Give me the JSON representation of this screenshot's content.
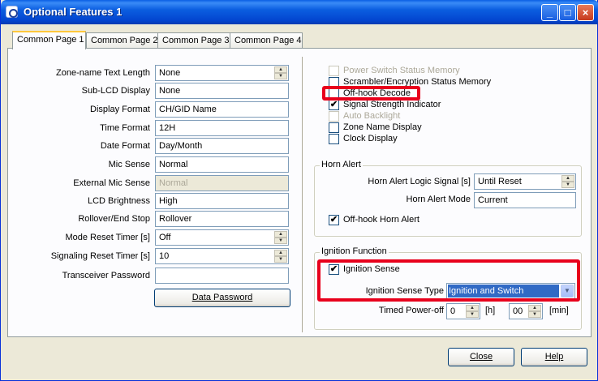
{
  "window": {
    "title": "Optional Features 1"
  },
  "tabs": [
    "Common Page 1",
    "Common Page 2",
    "Common Page 3",
    "Common Page 4"
  ],
  "left": {
    "rows": [
      {
        "label": "Zone-name Text Length",
        "value": "None",
        "spin": true,
        "disabled": false
      },
      {
        "label": "Sub-LCD Display",
        "value": "None",
        "spin": false,
        "disabled": false
      },
      {
        "label": "Display Format",
        "value": "CH/GID Name",
        "spin": false,
        "disabled": false
      },
      {
        "label": "Time Format",
        "value": "12H",
        "spin": false,
        "disabled": false
      },
      {
        "label": "Date Format",
        "value": "Day/Month",
        "spin": false,
        "disabled": false
      },
      {
        "label": "Mic Sense",
        "value": "Normal",
        "spin": false,
        "disabled": false
      },
      {
        "label": "External Mic Sense",
        "value": "Normal",
        "spin": false,
        "disabled": true
      },
      {
        "label": "LCD Brightness",
        "value": "High",
        "spin": false,
        "disabled": false
      },
      {
        "label": "Rollover/End Stop",
        "value": "Rollover",
        "spin": false,
        "disabled": false
      },
      {
        "label": "Mode Reset Timer [s]",
        "value": "Off",
        "spin": true,
        "disabled": false
      },
      {
        "label": "Signaling Reset Timer [s]",
        "value": "10",
        "spin": true,
        "disabled": false
      },
      {
        "label": "Transceiver Password",
        "value": "",
        "spin": false,
        "disabled": false
      }
    ],
    "data_password_button": "Data Password"
  },
  "right": {
    "checkboxes": [
      {
        "label": "Power Switch Status Memory",
        "checked": false,
        "disabled": true
      },
      {
        "label": "Scrambler/Encryption Status Memory",
        "checked": false,
        "disabled": false
      },
      {
        "label": "Off-hook Decode",
        "checked": false,
        "disabled": false
      },
      {
        "label": "Signal Strength Indicator",
        "checked": true,
        "disabled": false
      },
      {
        "label": "Auto Backlight",
        "checked": false,
        "disabled": true
      },
      {
        "label": "Zone Name Display",
        "checked": false,
        "disabled": false
      },
      {
        "label": "Clock Display",
        "checked": false,
        "disabled": false
      }
    ],
    "horn_alert": {
      "title": "Horn Alert",
      "logic_signal_label": "Horn Alert Logic Signal [s]",
      "logic_signal_value": "Until Reset",
      "mode_label": "Horn Alert Mode",
      "mode_value": "Current",
      "offhook_label": "Off-hook Horn Alert",
      "offhook_checked": true
    },
    "ignition": {
      "title": "Ignition Function",
      "sense_label": "Ignition Sense",
      "sense_checked": true,
      "type_label": "Ignition Sense Type",
      "type_value": "Ignition and Switch",
      "timed_label": "Timed Power-off",
      "hours_value": "0",
      "hours_unit": "[h]",
      "minutes_value": "00",
      "minutes_unit": "[min]"
    }
  },
  "footer": {
    "close": "Close",
    "help": "Help"
  },
  "check_glyph": "✔",
  "icons": {
    "minimize": "minimize-icon",
    "maximize": "maximize-icon",
    "close": "close-icon"
  },
  "colors": {
    "titlebar": "#0a5fe4",
    "highlight": "#e8001c",
    "selection": "#316ac5"
  }
}
